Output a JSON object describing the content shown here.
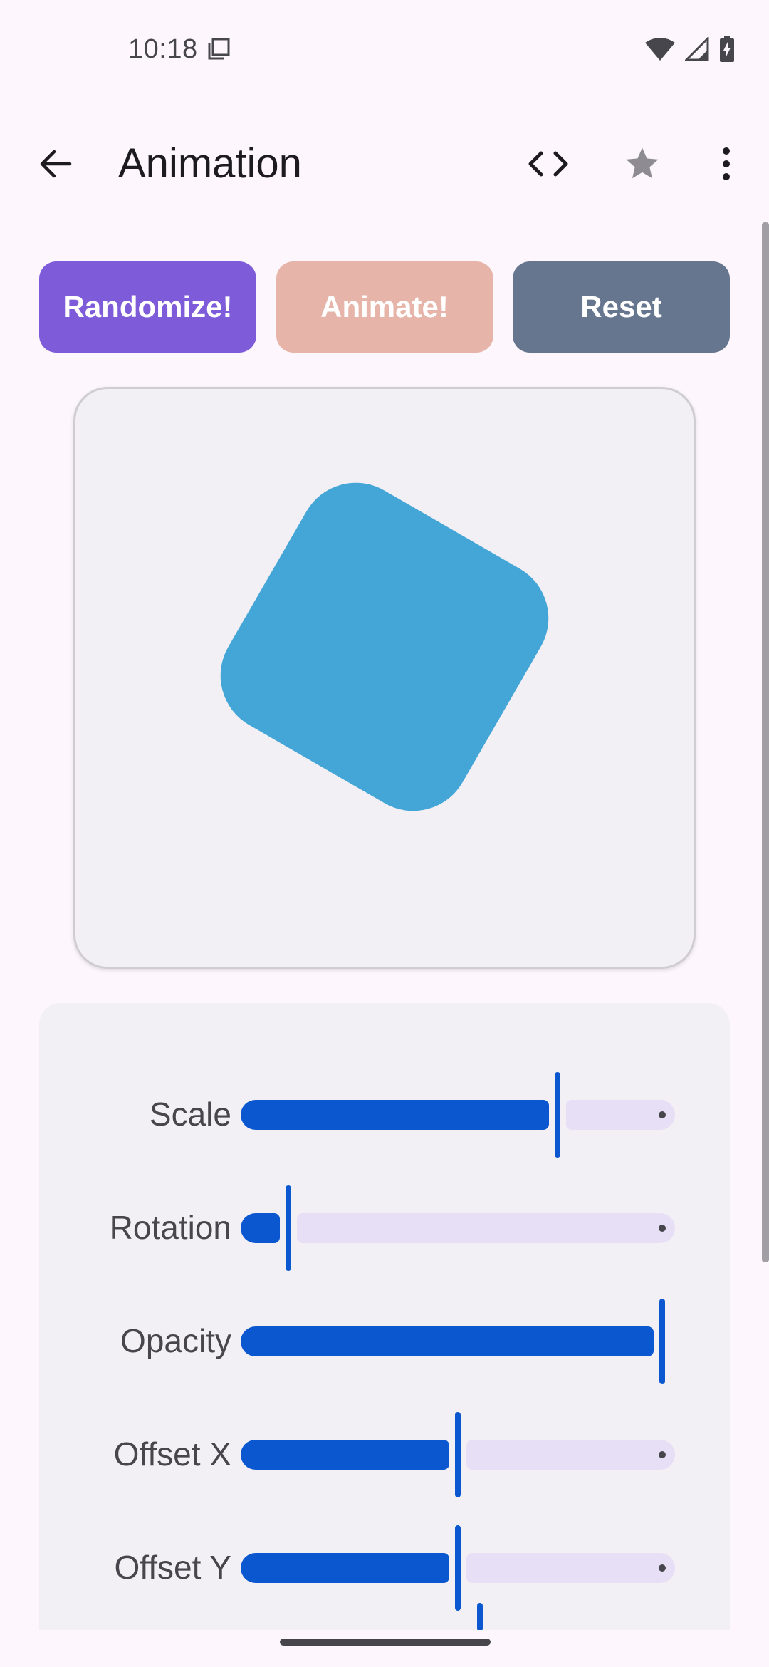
{
  "status": {
    "time": "10:18",
    "left_icon": "screenshot-icon",
    "right_icons": [
      "wifi-icon",
      "signal-icon",
      "battery-charging-icon"
    ]
  },
  "app_bar": {
    "title": "Animation",
    "icons": {
      "back": "arrow-back-icon",
      "code": "code-icon",
      "favorite": "star-icon",
      "more": "more-vert-icon"
    }
  },
  "actions": {
    "randomize": {
      "label": "Randomize!",
      "color": "#7e5bd9"
    },
    "animate": {
      "label": "Animate!",
      "color": "#e6b4a8"
    },
    "reset": {
      "label": "Reset",
      "color": "#65768e"
    }
  },
  "preview": {
    "shape_color": "#43a6d7",
    "shape_rotation_deg": 30
  },
  "sliders": [
    {
      "label": "Scale",
      "value": 0.73
    },
    {
      "label": "Rotation",
      "value": 0.11
    },
    {
      "label": "Opacity",
      "value": 0.97
    },
    {
      "label": "Offset X",
      "value": 0.5
    },
    {
      "label": "Offset Y",
      "value": 0.5
    }
  ],
  "colors": {
    "accent": "#0b57d0",
    "track_inactive": "#e6dff6",
    "background": "#fdf7fd",
    "card": "#f2eff5"
  }
}
